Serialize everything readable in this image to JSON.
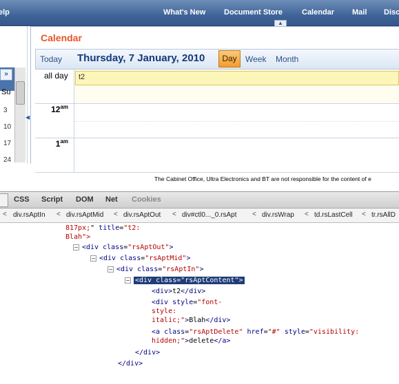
{
  "topnav": {
    "items": [
      "elp",
      "What's New",
      "Document Store",
      "Calendar",
      "Mail",
      "Disc"
    ]
  },
  "leftpane": {
    "next_label": "»",
    "day_header": "Su",
    "days": [
      "3",
      "10",
      "17",
      "24"
    ]
  },
  "calendar": {
    "title": "Calendar",
    "today_label": "Today",
    "date": "Thursday, 7 January, 2010",
    "day_label": "Day",
    "week_label": "Week",
    "month_label": "Month",
    "allday_label": "all day",
    "appointment": "t2",
    "hours": [
      {
        "h": "12",
        "ap": "am"
      },
      {
        "h": "1",
        "ap": "am"
      }
    ]
  },
  "disclaimer": "The Cabinet Office, Ultra Electronics and BT are not responsible for the content of e",
  "firebug": {
    "tabs": [
      "CSS",
      "Script",
      "DOM",
      "Net",
      "Cookies"
    ],
    "breadcrumbs": [
      "div.rsAptIn",
      "div.rsAptMid",
      "div.rsAptOut",
      "div#ctl0..._0.rsApt",
      "div.rsWrap",
      "td.rsLastCell",
      "tr.rsAllD"
    ],
    "html": {
      "l1_val": "817px;",
      "l1_attr": "title",
      "l1_title": "\"t2:",
      "l2": "Blah\">",
      "rsAptOut": "\"rsAptOut\"",
      "rsAptMid": "\"rsAptMid\"",
      "rsAptIn": "\"rsAptIn\"",
      "rsAptContent": "\"rsAptContent\"",
      "t2_text": "t2",
      "style_val1": "\"font-",
      "style_val2": "style:",
      "style_val3": "italic;\"",
      "blah_text": "Blah",
      "delete_class": "\"rsAptDelete\"",
      "href_val": "\"#\"",
      "style_val4": "\"visibility:",
      "style_val5": "hidden;\"",
      "delete_text": "delete"
    }
  }
}
